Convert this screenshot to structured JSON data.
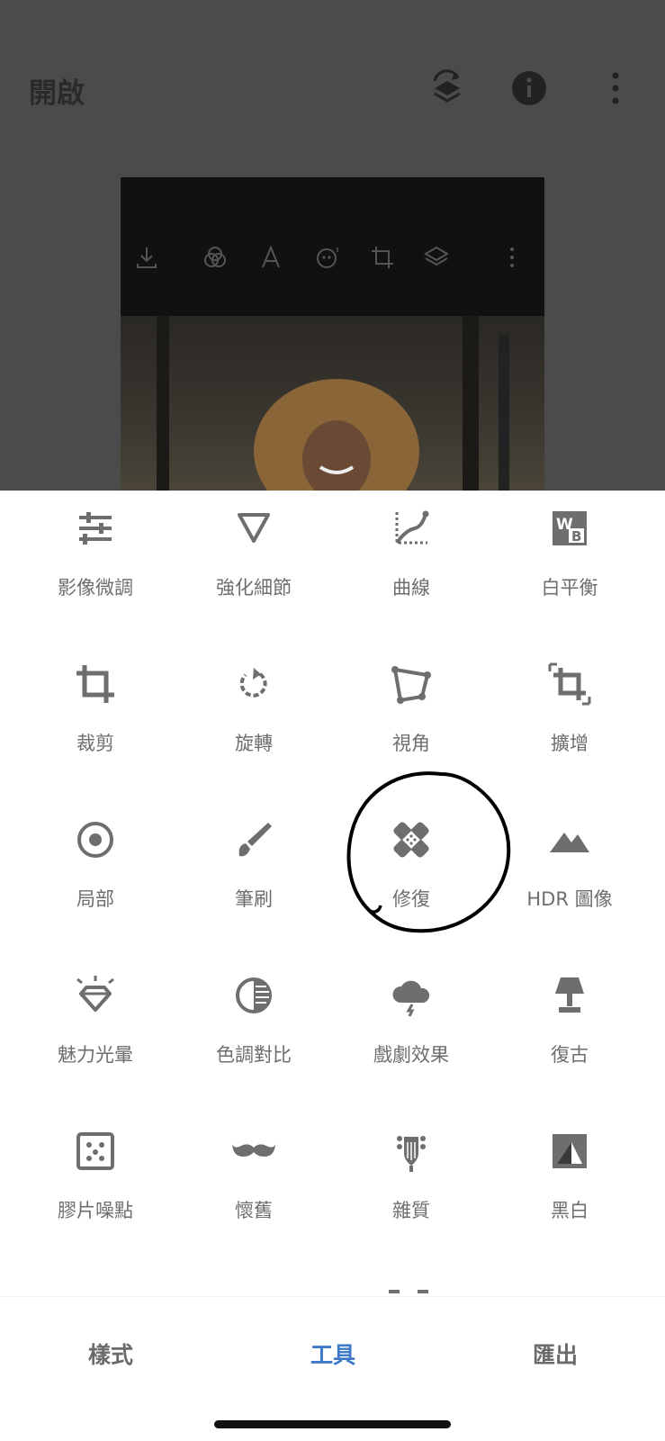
{
  "header": {
    "title": "開啟"
  },
  "tools": [
    {
      "label": "影像微調",
      "icon": "sliders-icon"
    },
    {
      "label": "強化細節",
      "icon": "details-triangle-icon"
    },
    {
      "label": "曲線",
      "icon": "curves-icon"
    },
    {
      "label": "白平衡",
      "icon": "white-balance-icon"
    },
    {
      "label": "裁剪",
      "icon": "crop-icon"
    },
    {
      "label": "旋轉",
      "icon": "rotate-icon"
    },
    {
      "label": "視角",
      "icon": "perspective-icon"
    },
    {
      "label": "擴增",
      "icon": "expand-icon"
    },
    {
      "label": "局部",
      "icon": "selective-icon"
    },
    {
      "label": "筆刷",
      "icon": "brush-icon"
    },
    {
      "label": "修復",
      "icon": "healing-bandage-icon"
    },
    {
      "label": "HDR 圖像",
      "icon": "hdr-mountain-icon"
    },
    {
      "label": "魅力光暈",
      "icon": "glamour-glow-icon"
    },
    {
      "label": "色調對比",
      "icon": "tonal-contrast-icon"
    },
    {
      "label": "戲劇效果",
      "icon": "drama-cloud-icon"
    },
    {
      "label": "復古",
      "icon": "vintage-lamp-icon"
    },
    {
      "label": "膠片噪點",
      "icon": "grainy-film-icon"
    },
    {
      "label": "懷舊",
      "icon": "retrolux-mustache-icon"
    },
    {
      "label": "雜質",
      "icon": "grunge-guitar-icon"
    },
    {
      "label": "黑白",
      "icon": "black-white-icon"
    }
  ],
  "bottom_nav": {
    "styles": "樣式",
    "tools": "工具",
    "export": "匯出"
  },
  "colors": {
    "accent": "#3d78c9",
    "icon": "#6e6e6e",
    "label": "#6e6e6e"
  }
}
